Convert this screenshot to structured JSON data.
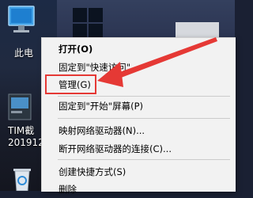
{
  "desktop": {
    "icons": [
      {
        "label": "此电",
        "icon": "computer-icon"
      },
      {
        "label": "TIM截\n201912",
        "icon": "screenshot-file-icon"
      },
      {
        "label": "",
        "icon": "recycle-bin-icon"
      }
    ]
  },
  "context_menu": {
    "groups": [
      [
        {
          "label": "打开(O)",
          "bold": true
        },
        {
          "label": "固定到\"快速访问\""
        }
      ],
      [
        {
          "label": "管理(G)",
          "highlighted": true
        }
      ],
      [
        {
          "label": "固定到\"开始\"屏幕(P)"
        }
      ],
      [
        {
          "label": "映射网络驱动器(N)..."
        },
        {
          "label": "断开网络驱动器的连接(C)..."
        }
      ],
      [
        {
          "label": "创建快捷方式(S)"
        },
        {
          "label": "删除"
        }
      ]
    ]
  },
  "annotation": {
    "color": "#e53935",
    "highlighted_item": "管理(G)"
  }
}
